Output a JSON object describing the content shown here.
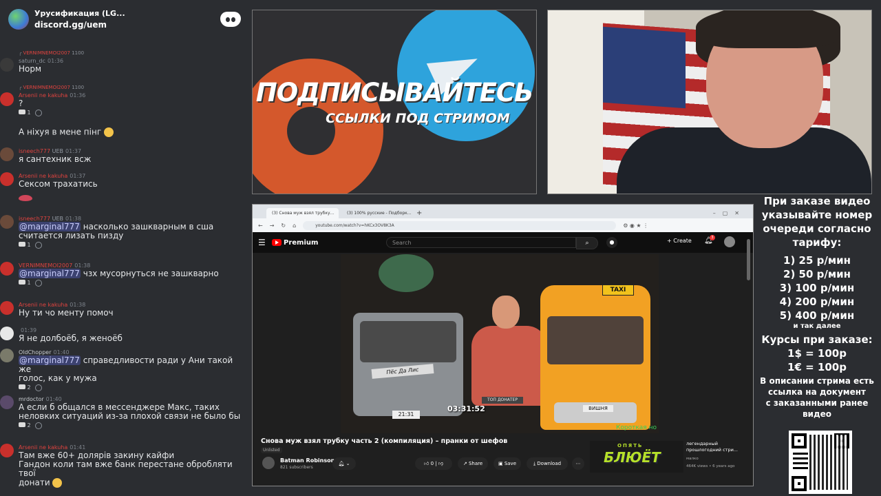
{
  "discord": {
    "server_name": "Урусификация (LG...",
    "invite": "discord.gg/uem",
    "messages": [
      {
        "reply_name": "VERNIMNEMOI2007",
        "reply_text": "1100",
        "name": "saturn_dc",
        "time": "01:36",
        "lines": [
          "Норм"
        ],
        "avatar_color": "#3a3a3a",
        "name_style": "gray"
      },
      {
        "reply_name": "VERNIMNEMOI2007",
        "reply_text": "1100",
        "name": "Arsenii ne kakuha",
        "time": "01:36",
        "lines": [
          "?"
        ],
        "reactions": [
          {
            "count": "1"
          }
        ],
        "avatar_color": "#c9302c"
      },
      {
        "name": "",
        "time": "",
        "lines": [
          "А ніхуя в мене пінг"
        ],
        "avatar_color": "",
        "continuation": true,
        "emoji": true
      },
      {
        "name": "isneech777",
        "tag": "UEB",
        "time": "01:37",
        "lines": [
          "я сантехник всж"
        ],
        "avatar_color": "#6a4a3a",
        "name_style": "red"
      },
      {
        "name": "Arsenii ne kakuha",
        "time": "01:37",
        "lines": [
          "Сексом трахатись"
        ],
        "avatar_color": "#c9302c",
        "lips": true
      },
      {
        "name": "isneech777",
        "tag": "UEB",
        "time": "01:38",
        "mention": "@marginal777",
        "lines": [
          " насколько зашкварным в сша",
          "считается лизать пизду"
        ],
        "reactions": [
          {
            "count": "1"
          }
        ],
        "avatar_color": "#6a4a3a"
      },
      {
        "name": "VERNIMNEMOI2007",
        "time": "01:38",
        "mention": "@marginal777",
        "lines": [
          " чзх мусорнуться не зашкварно"
        ],
        "reactions": [
          {
            "count": "1"
          }
        ],
        "avatar_color": "#c9302c"
      },
      {
        "name": "Arsenii ne kakuha",
        "time": "01:38",
        "lines": [
          "Ну ти чо менту помоч"
        ],
        "avatar_color": "#c9302c"
      },
      {
        "name": "",
        "time": "01:39",
        "lines": [
          "Я не долбоёб, я женоёб"
        ],
        "avatar_color": "#e8e8e8"
      },
      {
        "name": "OldChopper",
        "time": "01:40",
        "mention": "@marginal777",
        "lines": [
          " справедливости ради у Ани такой же",
          "голос, как у мужа"
        ],
        "reactions": [
          {
            "count": "2"
          }
        ],
        "avatar_color": "#7a7a6a",
        "name_style": "plain"
      },
      {
        "name": "mrdoctor",
        "time": "01:40",
        "lines": [
          "А если б общался в мессенджере Макс, таких",
          "неловких ситуаций из-за плохой связи не было бы"
        ],
        "reactions": [
          {
            "count": "2"
          }
        ],
        "avatar_color": "#5a4a6a",
        "name_style": "plain"
      },
      {
        "name": "Arsenii ne kakuha",
        "time": "01:41",
        "lines": [
          "Там вже 60+ долярів закину кайфи",
          "Гандон коли там вже банк перестане обробляти твої",
          "донати"
        ],
        "avatar_color": "#c9302c",
        "emoji_end": true
      }
    ]
  },
  "promo": {
    "title": "ПОДПИСЫВАЙТЕСЬ",
    "subtitle": "ССЫЛКИ ПОД СТРИМОМ"
  },
  "browser": {
    "tabs": [
      "(3) Снова муж взял трубку...",
      "(3) 100% русские - Подборк..."
    ],
    "url": "youtube.com/watch?v=hKCx3OV8K3A",
    "youtube": {
      "logo": "Premium",
      "search_placeholder": "Search",
      "create": "Create",
      "notifications": "3",
      "video": {
        "title": "Снова муж взял трубку часть 2 (компиляция) – пранки от шефов",
        "visibility": "Unlisted",
        "channel": "Batman Robinson",
        "subscribers": "821 subscribers",
        "likes": "0",
        "share": "Share",
        "save": "Save",
        "download": "Download",
        "overlay_duration": "03:31:52",
        "overlay_timer": "21:31",
        "overlay_banner": "Пёс Да Лис",
        "overlay_taxi": "TAXI",
        "overlay_plate": "ВИШНЯ",
        "overlay_top": "ТОП ДОНАТЕР",
        "overlay_short": "Короткая но"
      },
      "suggestion": {
        "title": "легендарный прошлогодний стри...",
        "channel": "малко",
        "meta": "464K views • 6 years ago",
        "thumb_top": "ОПЯТЬ",
        "thumb_big": "БЛЮЁТ"
      }
    }
  },
  "info": {
    "heading": [
      "При заказе видео",
      "указывайте номер",
      "очереди согласно",
      "тарифу:"
    ],
    "tariffs": [
      "1) 25 р/мин",
      "2) 50 р/мин",
      "3) 100 р/мин",
      "4) 200 р/мин",
      "5) 400 р/мин"
    ],
    "etc": "и так далее",
    "rates_title": "Курсы при заказе:",
    "rates": [
      "1$ = 100р",
      "1€ = 100р"
    ],
    "desc": [
      "В описании стрима есть",
      "ссылка на документ",
      "с заказанными ранее",
      "видео"
    ]
  }
}
